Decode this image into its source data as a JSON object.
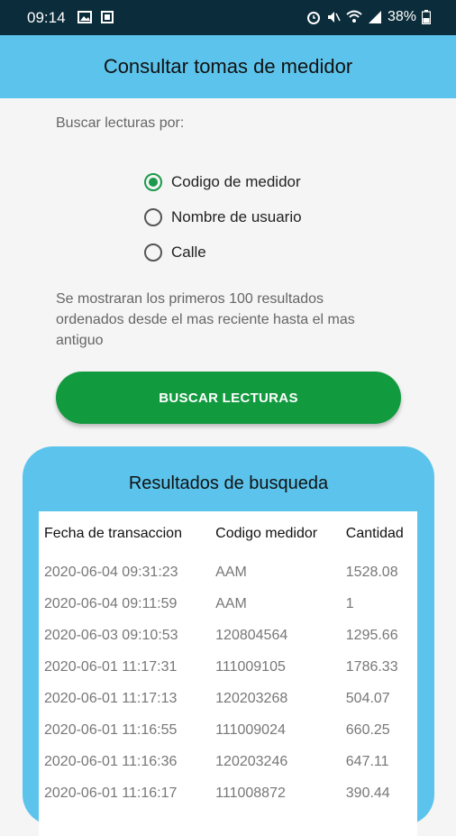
{
  "status_bar": {
    "time": "09:14",
    "battery": "38%",
    "icons": [
      "gallery-icon",
      "notification-icon",
      "alarm-icon",
      "mute-icon",
      "wifi-icon",
      "signal-icon",
      "battery-icon"
    ]
  },
  "header": {
    "title": "Consultar tomas de medidor"
  },
  "search": {
    "prompt": "Buscar lecturas por:",
    "options": [
      {
        "label": "Codigo de medidor",
        "selected": true
      },
      {
        "label": "Nombre de usuario",
        "selected": false
      },
      {
        "label": "Calle",
        "selected": false
      }
    ],
    "info": "Se mostraran los primeros 100 resultados ordenados desde el mas reciente hasta el mas antiguo",
    "button_label": "BUSCAR LECTURAS"
  },
  "results": {
    "title": "Resultados de busqueda",
    "columns": [
      "Fecha de transaccion",
      "Codigo medidor",
      "Cantidad"
    ],
    "rows": [
      [
        "2020-06-04 09:31:23",
        "AAM",
        "1528.08"
      ],
      [
        "2020-06-04 09:11:59",
        "AAM",
        "1"
      ],
      [
        "2020-06-03 09:10:53",
        "120804564",
        "1295.66"
      ],
      [
        "2020-06-01 11:17:31",
        "111009105",
        "1786.33"
      ],
      [
        "2020-06-01 11:17:13",
        "120203268",
        "504.07"
      ],
      [
        "2020-06-01 11:16:55",
        "111009024",
        "660.25"
      ],
      [
        "2020-06-01 11:16:36",
        "120203246",
        "647.11"
      ],
      [
        "2020-06-01 11:16:17",
        "111008872",
        "390.44"
      ]
    ]
  },
  "colors": {
    "status_bar": "#0b2c3a",
    "accent_blue": "#5cc4ec",
    "accent_green": "#129a3f"
  }
}
